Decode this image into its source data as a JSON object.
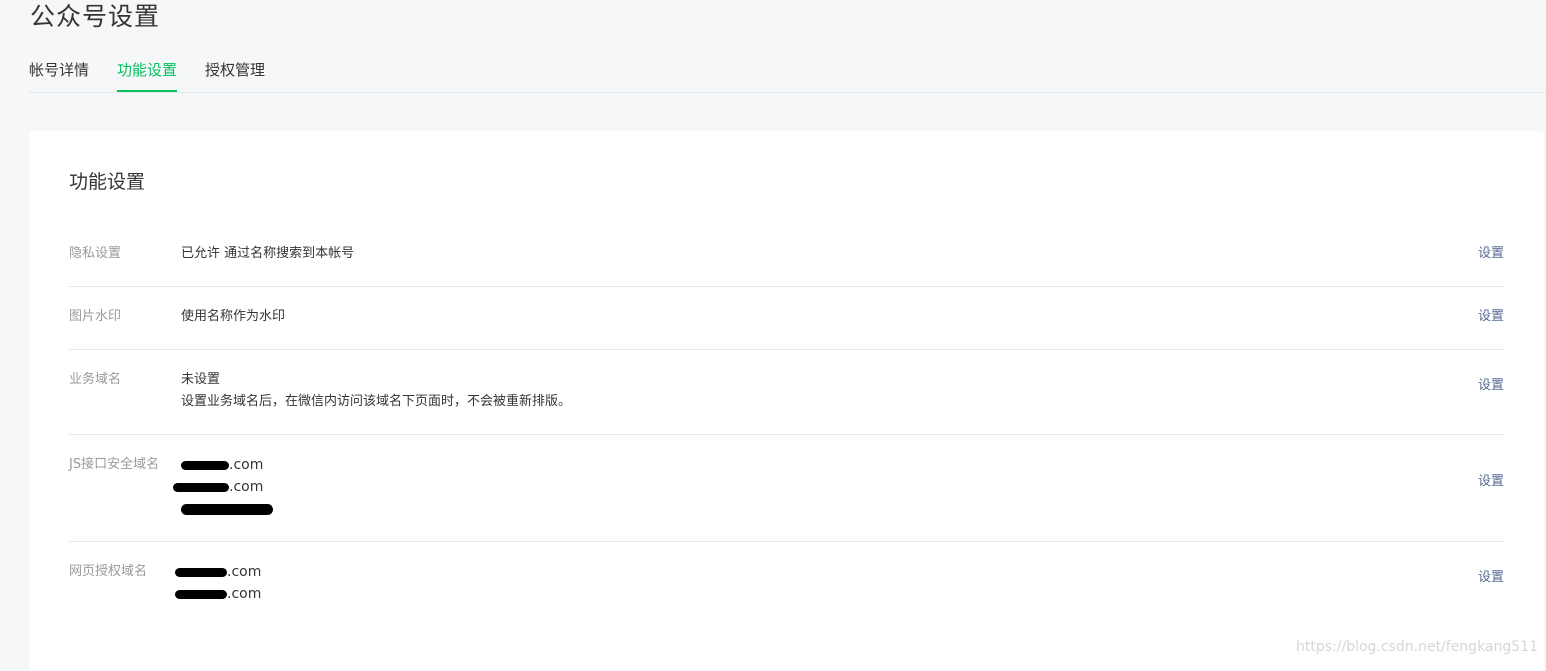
{
  "page": {
    "title": "公众号设置"
  },
  "tabs": [
    {
      "label": "帐号详情",
      "active": false
    },
    {
      "label": "功能设置",
      "active": true
    },
    {
      "label": "授权管理",
      "active": false
    }
  ],
  "card": {
    "title": "功能设置",
    "rows": [
      {
        "label": "隐私设置",
        "values": [
          "已允许 通过名称搜索到本帐号"
        ],
        "action": "设置"
      },
      {
        "label": "图片水印",
        "values": [
          "使用名称作为水印"
        ],
        "action": "设置"
      },
      {
        "label": "业务域名",
        "values": [
          "未设置",
          "设置业务域名后，在微信内访问该域名下页面时，不会被重新排版。"
        ],
        "action": "设置"
      },
      {
        "label": "JS接口安全域名",
        "values": [
          ".com",
          ".com",
          ""
        ],
        "action": "设置"
      },
      {
        "label": "网页授权域名",
        "values": [
          ".com",
          ".com"
        ],
        "action": "设置"
      }
    ]
  },
  "watermark": "https://blog.csdn.net/fengkang511",
  "colors": {
    "accent": "#07c160",
    "link": "#576b95",
    "background": "#f6f7f9"
  }
}
